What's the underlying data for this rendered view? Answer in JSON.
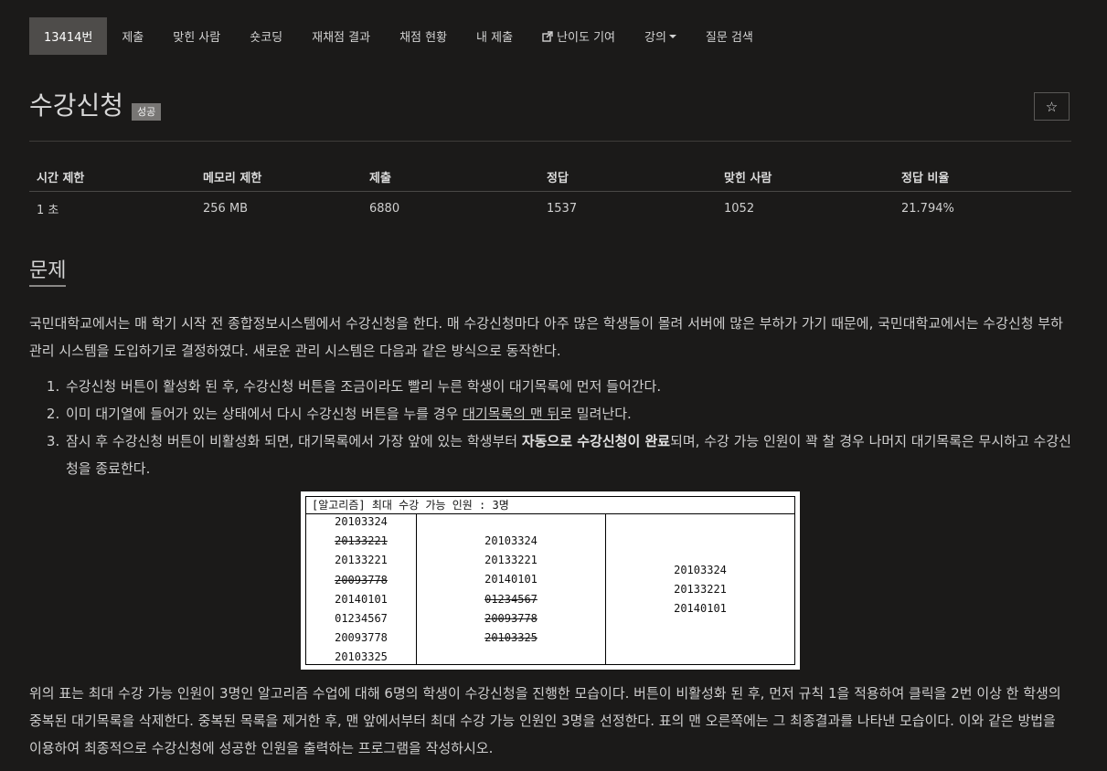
{
  "nav": {
    "items": [
      {
        "label": "13414번",
        "active": true
      },
      {
        "label": "제출"
      },
      {
        "label": "맞힌 사람"
      },
      {
        "label": "숏코딩"
      },
      {
        "label": "재채점 결과"
      },
      {
        "label": "채점 현황"
      },
      {
        "label": "내 제출"
      },
      {
        "label": "난이도 기여",
        "icon": "external-link-icon"
      },
      {
        "label": "강의",
        "icon": "caret-down-icon"
      },
      {
        "label": "질문 검색"
      }
    ]
  },
  "problem": {
    "title": "수강신청",
    "badge": "성공",
    "star_icon": "☆"
  },
  "limits": {
    "headers": [
      "시간 제한",
      "메모리 제한",
      "제출",
      "정답",
      "맞힌 사람",
      "정답 비율"
    ],
    "values": [
      "1 초",
      "256 MB",
      "6880",
      "1537",
      "1052",
      "21.794%"
    ]
  },
  "section": {
    "title": "문제"
  },
  "content": {
    "intro": "국민대학교에서는 매 학기 시작 전 종합정보시스템에서 수강신청을 한다. 매 수강신청마다 아주 많은 학생들이 몰려 서버에 많은 부하가 가기 때문에, 국민대학교에서는 수강신청 부하 관리 시스템을 도입하기로 결정하였다. 새로운 관리 시스템은 다음과 같은 방식으로 동작한다.",
    "rule1": "수강신청 버튼이 활성화 된 후, 수강신청 버튼을 조금이라도 빨리 누른 학생이 대기목록에 먼저 들어간다.",
    "rule2_pre": "이미 대기열에 들어가 있는 상태에서 다시 수강신청 버튼을 누를 경우 ",
    "rule2_u": "대기목록의 맨 뒤",
    "rule2_post": "로 밀려난다.",
    "rule3_pre": "잠시 후 수강신청 버튼이 비활성화 되면, 대기목록에서 가장 앞에 있는 학생부터 ",
    "rule3_b": "자동으로 수강신청이 완료",
    "rule3_post": "되며, 수강 가능 인원이 꽉 찰 경우 나머지 대기목록은 무시하고 수강신청을 종료한다.",
    "outro": "위의 표는 최대 수강 가능 인원이 3명인 알고리즘 수업에 대해 6명의 학생이 수강신청을 진행한 모습이다. 버튼이 비활성화 된 후, 먼저 규칙 1을 적용하여 클릭을 2번 이상 한 학생의 중복된 대기목록을 삭제한다. 중복된 목록을 제거한 후, 맨 앞에서부터 최대 수강 가능 인원인 3명을 선정한다. 표의 맨 오른쪽에는 그 최종결과를 나타낸 모습이다. 이와 같은 방법을 이용하여 최종적으로 수강신청에 성공한 인원을 출력하는 프로그램을 작성하시오."
  },
  "figure": {
    "header": "[알고리즘] 최대 수강 가능 인원 : 3명",
    "col1": [
      {
        "v": "20103324"
      },
      {
        "v": "20133221",
        "struck": true
      },
      {
        "v": "20133221"
      },
      {
        "v": "20093778",
        "struck": true
      },
      {
        "v": "20140101"
      },
      {
        "v": "01234567"
      },
      {
        "v": "20093778"
      },
      {
        "v": "20103325"
      }
    ],
    "col2": [
      {
        "v": "20103324"
      },
      {
        "v": "20133221"
      },
      {
        "v": "20140101"
      },
      {
        "v": "01234567",
        "struck": true
      },
      {
        "v": "20093778",
        "struck": true
      },
      {
        "v": "20103325",
        "struck": true
      }
    ],
    "col3": [
      {
        "v": "20103324"
      },
      {
        "v": "20133221"
      },
      {
        "v": "20140101"
      }
    ]
  }
}
